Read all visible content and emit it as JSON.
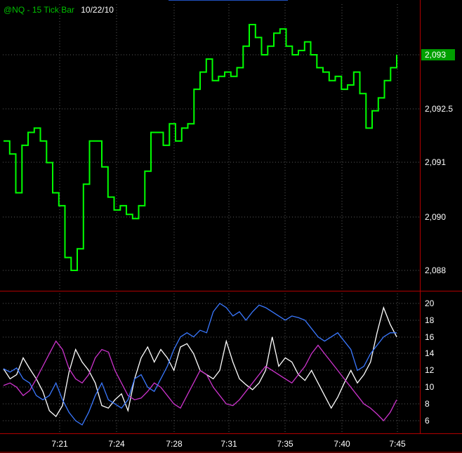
{
  "header": {
    "symbol_label": "@NQ - 15 Tick Bar",
    "date_label": "10/22/10"
  },
  "colors": {
    "background": "#000000",
    "price_bars": "#00ff00",
    "grid": "#5a5a5a",
    "axis_border": "#b00000",
    "indicator_series": [
      "#ffffff",
      "#cc33cc",
      "#3a78ff"
    ],
    "current_price_marker": "#00a000"
  },
  "chart_data": [
    {
      "type": "line",
      "title": "@NQ - 15 Tick Bar",
      "subtitle": "10/22/10",
      "xlabel": "",
      "ylabel": "",
      "grid": true,
      "x_ticks": [
        "7:21",
        "7:24",
        "7:28",
        "7:31",
        "7:35",
        "7:40",
        "7:45"
      ],
      "y_ticks": [
        "2,093",
        "2,092.5",
        "2,091",
        "2,090",
        "2,088"
      ],
      "ylim": [
        2087.6,
        2093.8
      ],
      "current_price_label": "2,093",
      "series": [
        {
          "values": [
            2091.0,
            2090.7,
            2089.8,
            2090.9,
            2091.2,
            2091.3,
            2091.0,
            2090.5,
            2089.8,
            2089.5,
            2088.3,
            2088.0,
            2088.5,
            2090.0,
            2091.0,
            2091.0,
            2090.4,
            2089.7,
            2089.4,
            2089.5,
            2089.3,
            2089.2,
            2089.5,
            2090.3,
            2091.2,
            2091.2,
            2090.9,
            2091.4,
            2091.0,
            2091.3,
            2091.4,
            2092.2,
            2092.6,
            2092.9,
            2092.4,
            2092.5,
            2092.6,
            2092.5,
            2092.7,
            2093.2,
            2093.7,
            2093.4,
            2093.0,
            2093.2,
            2093.5,
            2093.6,
            2093.2,
            2093.0,
            2093.1,
            2093.3,
            2093.0,
            2092.7,
            2092.6,
            2092.4,
            2092.5,
            2092.2,
            2092.3,
            2092.6,
            2092.1,
            2091.3,
            2091.7,
            2092.0,
            2092.4,
            2092.7,
            2093.0
          ]
        }
      ]
    },
    {
      "type": "line",
      "xlabel": "",
      "ylabel": "",
      "grid": true,
      "y_ticks": [
        "20",
        "18",
        "16",
        "14",
        "12",
        "10",
        "8",
        "6"
      ],
      "ylim": [
        5,
        21
      ],
      "x_ticks": [
        "7:21",
        "7:24",
        "7:28",
        "7:31",
        "7:35",
        "7:40",
        "7:45"
      ],
      "series": [
        {
          "values": [
            12.2,
            11.0,
            11.5,
            13.5,
            12.2,
            11.0,
            9.5,
            7.2,
            6.5,
            7.8,
            11.8,
            14.5,
            13.0,
            12.0,
            10.5,
            7.8,
            7.5,
            8.5,
            9.2,
            7.2,
            11.0,
            13.5,
            14.8,
            13.0,
            14.5,
            13.5,
            12.0,
            14.8,
            15.2,
            14.0,
            12.0,
            11.5,
            11.0,
            12.0,
            15.5,
            13.0,
            11.0,
            10.3,
            9.7,
            10.5,
            12.0,
            16.0,
            12.5,
            13.5,
            13.0,
            11.5,
            10.8,
            12.0,
            10.5,
            9.0,
            7.5,
            8.8,
            10.5,
            12.0,
            10.5,
            11.5,
            13.0,
            16.5,
            19.5,
            17.5,
            16.0
          ]
        },
        {
          "values": [
            10.2,
            10.5,
            10.0,
            9.0,
            9.6,
            11.0,
            12.5,
            14.0,
            15.5,
            14.5,
            12.2,
            11.0,
            10.5,
            11.5,
            13.5,
            14.5,
            14.2,
            12.0,
            10.5,
            9.0,
            8.5,
            8.7,
            9.5,
            10.5,
            10.0,
            9.0,
            8.0,
            7.5,
            9.0,
            10.5,
            12.0,
            11.5,
            10.0,
            9.0,
            8.0,
            7.8,
            8.5,
            9.5,
            10.5,
            11.5,
            12.5,
            12.0,
            11.5,
            11.0,
            10.5,
            11.5,
            12.5,
            14.0,
            15.0,
            14.0,
            13.0,
            12.0,
            11.0,
            10.0,
            9.0,
            8.0,
            7.5,
            6.8,
            6.0,
            7.0,
            8.5
          ]
        },
        {
          "values": [
            12.2,
            11.8,
            12.3,
            11.0,
            10.5,
            9.0,
            8.5,
            9.0,
            10.5,
            8.5,
            7.0,
            6.0,
            5.5,
            7.0,
            9.0,
            10.5,
            8.5,
            8.0,
            7.5,
            8.5,
            11.0,
            11.5,
            10.0,
            9.5,
            11.0,
            12.5,
            14.5,
            16.0,
            16.5,
            16.0,
            16.8,
            16.5,
            19.0,
            20.0,
            19.5,
            18.5,
            19.0,
            18.0,
            19.0,
            19.8,
            19.5,
            19.0,
            18.5,
            18.0,
            18.5,
            18.3,
            18.0,
            17.0,
            16.0,
            15.5,
            16.0,
            16.5,
            15.5,
            14.5,
            12.0,
            12.5,
            14.0,
            15.0,
            16.0,
            16.5,
            16.5
          ]
        }
      ]
    }
  ]
}
